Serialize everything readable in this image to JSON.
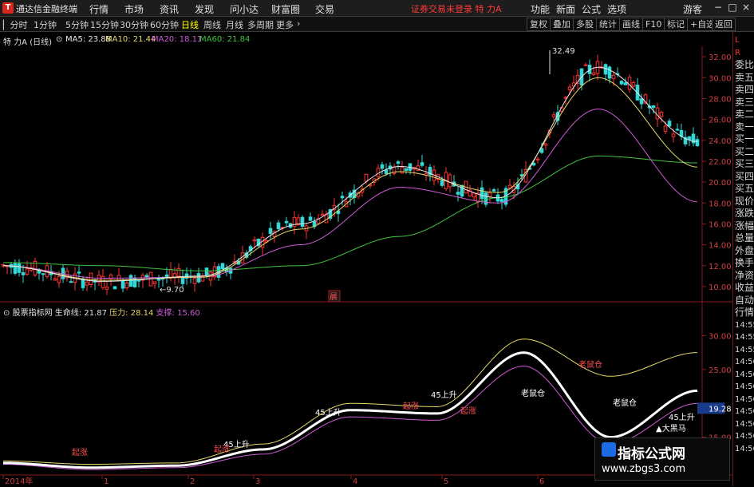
{
  "titlebar": {
    "app_name": "通达信金融终端",
    "menus": [
      "行情",
      "市场",
      "资讯",
      "发现",
      "问小达",
      "财富圈",
      "交易"
    ],
    "status": "证券交易未登录  特 力A",
    "right_menus": [
      "功能",
      "新面",
      "公式",
      "选项",
      "游客"
    ]
  },
  "toolbar": {
    "periods": [
      "分时",
      "1分钟",
      "5分钟",
      "15分钟",
      "30分钟",
      "60分钟",
      "日线",
      "周线",
      "月线",
      "多周期",
      "更多"
    ],
    "selected": "日线",
    "right_buttons": [
      "复权",
      "叠加",
      "多股",
      "统计",
      "画线",
      "F10",
      "标记",
      "+自选",
      "返回"
    ]
  },
  "chart": {
    "stock_label": "特 力A (日线)",
    "ma": [
      {
        "name": "MA5",
        "value": "23.88",
        "color": "#e8e8e8"
      },
      {
        "name": "MA10",
        "value": "21.44",
        "color": "#e6d96a"
      },
      {
        "name": "MA20",
        "value": "18.11",
        "color": "#d05ad8"
      },
      {
        "name": "MA60",
        "value": "21.84",
        "color": "#3ec43e"
      }
    ],
    "y_ticks": [
      "32.00",
      "30.00",
      "28.00",
      "26.00",
      "24.00",
      "22.00",
      "20.00",
      "18.00",
      "16.00",
      "14.00",
      "12.00",
      "10.00"
    ],
    "high_label": "32.49",
    "low_label": "9.70",
    "marker_label": "晨"
  },
  "indicator": {
    "title": "股票指标网",
    "lifeline_label": "生命线:",
    "lifeline_value": "21.87",
    "pressure_label": "压力:",
    "pressure_value": "28.14",
    "support_label": "支撑:",
    "support_value": "15.60",
    "y_ticks": [
      "30.00",
      "25.00",
      "19.28",
      "15.00"
    ],
    "annotations": [
      "45上升",
      "45上升",
      "45上升",
      "老鼠仓",
      "老鼠仓",
      "老鼠仓",
      "45上升",
      "▲大黑马",
      "起涨",
      "起涨",
      "起涨",
      "起涨"
    ]
  },
  "xaxis": [
    "2014年",
    "1",
    "2",
    "3",
    "4",
    "5",
    "6"
  ],
  "right_panel": [
    "L",
    "R",
    "委比",
    "卖五",
    "卖四",
    "卖三",
    "卖二",
    "卖一",
    "买一",
    "买二",
    "买三",
    "买四",
    "买五",
    "现价",
    "涨跌",
    "涨幅",
    "总量",
    "外盘",
    "换手",
    "净资",
    "收益",
    "自动",
    "行情",
    "14:55",
    "14:55",
    "14:55",
    "14:56",
    "14:56",
    "14:56",
    "14:56",
    "14:56",
    "14:56",
    "14:56",
    "14:56"
  ],
  "watermark": {
    "title": "指标公式网",
    "url": "www.zbgs3.com"
  },
  "chart_data": {
    "type": "line",
    "x": [
      "2014年",
      "1",
      "2",
      "3",
      "4",
      "5",
      "6"
    ],
    "ylim": [
      9,
      33
    ],
    "series": [
      {
        "name": "MA60",
        "values": [
          12.3,
          12.0,
          11.5,
          12.0,
          14.8,
          18.5,
          22.5,
          21.84
        ]
      },
      {
        "name": "MA20",
        "values": [
          12.0,
          10.8,
          10.9,
          14.0,
          19.5,
          18.0,
          27.0,
          18.11
        ]
      },
      {
        "name": "MA10",
        "values": [
          12.0,
          10.6,
          10.9,
          15.5,
          21.0,
          19.0,
          30.0,
          21.44
        ]
      },
      {
        "name": "MA5",
        "values": [
          12.0,
          10.5,
          11.0,
          16.0,
          21.5,
          18.5,
          31.0,
          23.88
        ]
      }
    ]
  }
}
